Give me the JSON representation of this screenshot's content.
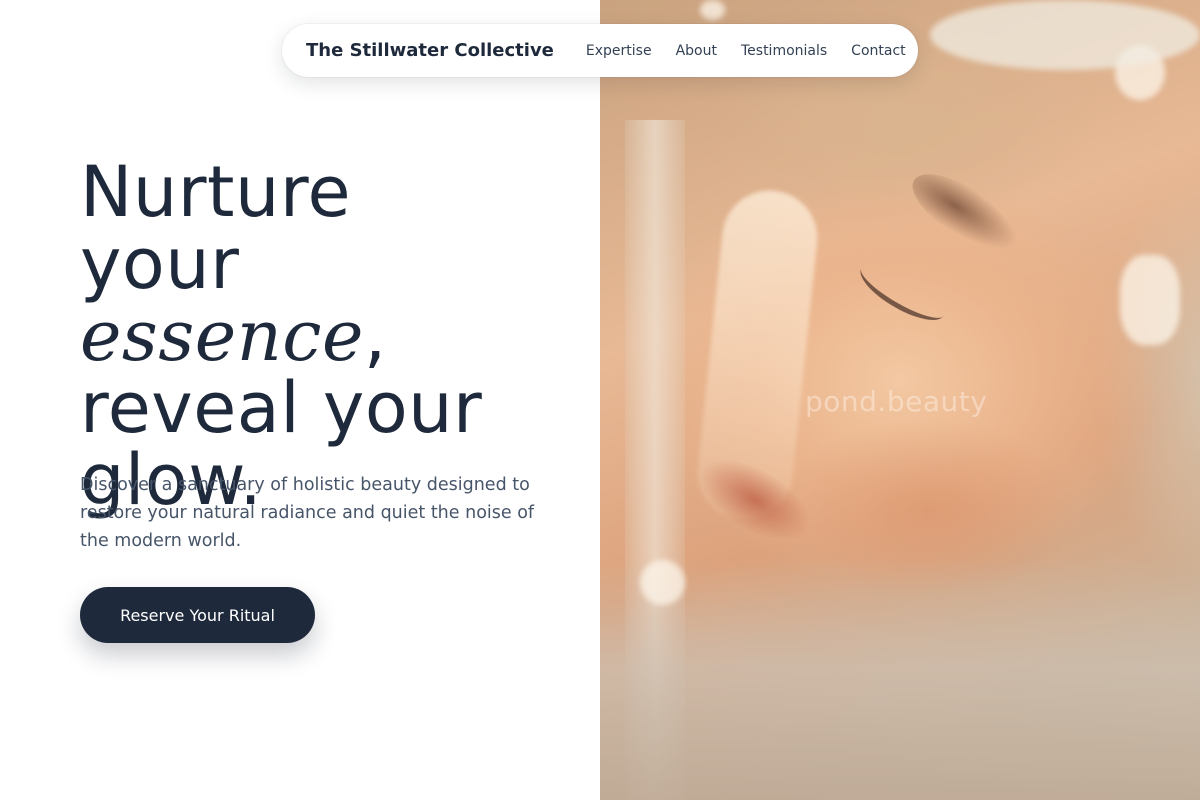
{
  "nav": {
    "brand": "The Stillwater Collective",
    "links": [
      "Expertise",
      "About",
      "Testimonials",
      "Contact"
    ]
  },
  "hero": {
    "headline": {
      "line1": "Nurture",
      "line2_pre": "your ",
      "line2_accent": "essence",
      "line2_post": ",",
      "line3": "reveal your",
      "line4": "glow."
    },
    "subcopy": "Discover a sanctuary of holistic beauty designed to restore your natural radiance and quiet the noise of the modern world.",
    "cta_label": "Reserve Your Ritual"
  },
  "image": {
    "watermark": "pond.beauty"
  },
  "colors": {
    "primary": "#1e293b",
    "body_text": "#475569",
    "background": "#ffffff"
  }
}
